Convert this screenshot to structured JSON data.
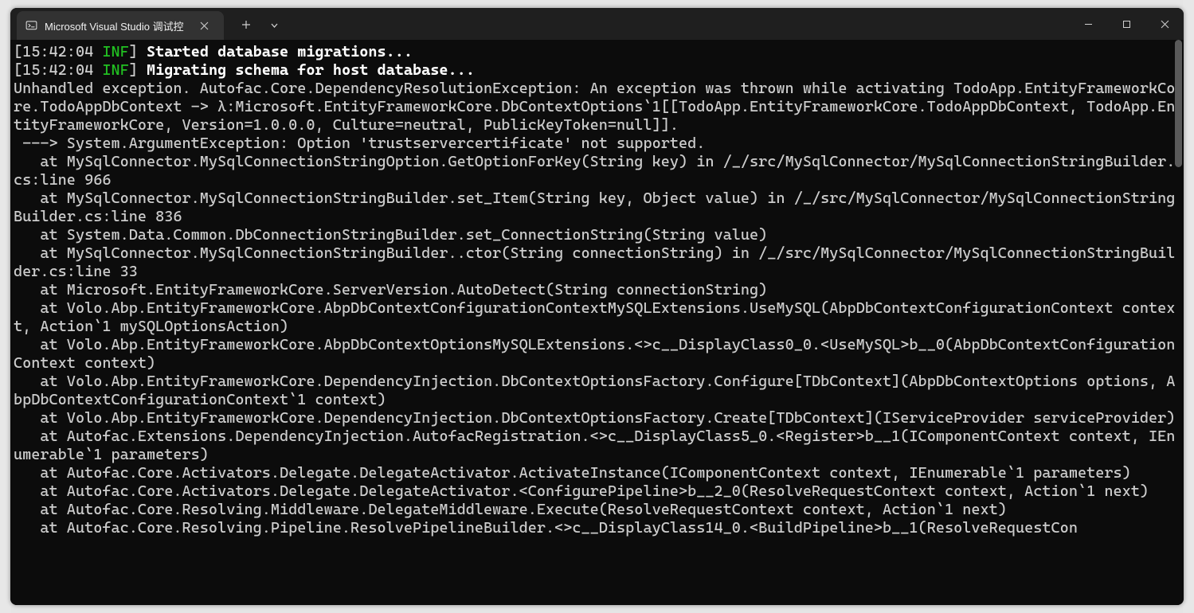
{
  "titlebar": {
    "tab_label": "Microsoft Visual Studio 调试控",
    "icons": {
      "terminal": "terminal-icon",
      "close_tab": "close-icon",
      "new_tab": "plus-icon",
      "dropdown": "chevron-down-icon",
      "minimize": "minimize-icon",
      "maximize": "maximize-icon",
      "win_close": "close-icon"
    }
  },
  "log": {
    "line1_time": "15:42:04",
    "line1_level": "INF",
    "line1_msg": "Started database migrations...",
    "line2_time": "15:42:04",
    "line2_level": "INF",
    "line2_msg": "Migrating schema for host database..."
  },
  "trace": "Unhandled exception. Autofac.Core.DependencyResolutionException: An exception was thrown while activating TodoApp.EntityFrameworkCore.TodoAppDbContext -> λ:Microsoft.EntityFrameworkCore.DbContextOptions`1[[TodoApp.EntityFrameworkCore.TodoAppDbContext, TodoApp.EntityFrameworkCore, Version=1.0.0.0, Culture=neutral, PublicKeyToken=null]].\n ---> System.ArgumentException: Option 'trustservercertificate' not supported.\n   at MySqlConnector.MySqlConnectionStringOption.GetOptionForKey(String key) in /_/src/MySqlConnector/MySqlConnectionStringBuilder.cs:line 966\n   at MySqlConnector.MySqlConnectionStringBuilder.set_Item(String key, Object value) in /_/src/MySqlConnector/MySqlConnectionStringBuilder.cs:line 836\n   at System.Data.Common.DbConnectionStringBuilder.set_ConnectionString(String value)\n   at MySqlConnector.MySqlConnectionStringBuilder..ctor(String connectionString) in /_/src/MySqlConnector/MySqlConnectionStringBuilder.cs:line 33\n   at Microsoft.EntityFrameworkCore.ServerVersion.AutoDetect(String connectionString)\n   at Volo.Abp.EntityFrameworkCore.AbpDbContextConfigurationContextMySQLExtensions.UseMySQL(AbpDbContextConfigurationContext context, Action`1 mySQLOptionsAction)\n   at Volo.Abp.EntityFrameworkCore.AbpDbContextOptionsMySQLExtensions.<>c__DisplayClass0_0.<UseMySQL>b__0(AbpDbContextConfigurationContext context)\n   at Volo.Abp.EntityFrameworkCore.DependencyInjection.DbContextOptionsFactory.Configure[TDbContext](AbpDbContextOptions options, AbpDbContextConfigurationContext`1 context)\n   at Volo.Abp.EntityFrameworkCore.DependencyInjection.DbContextOptionsFactory.Create[TDbContext](IServiceProvider serviceProvider)\n   at Autofac.Extensions.DependencyInjection.AutofacRegistration.<>c__DisplayClass5_0.<Register>b__1(IComponentContext context, IEnumerable`1 parameters)\n   at Autofac.Core.Activators.Delegate.DelegateActivator.ActivateInstance(IComponentContext context, IEnumerable`1 parameters)\n   at Autofac.Core.Activators.Delegate.DelegateActivator.<ConfigurePipeline>b__2_0(ResolveRequestContext context, Action`1 next)\n   at Autofac.Core.Resolving.Middleware.DelegateMiddleware.Execute(ResolveRequestContext context, Action`1 next)\n   at Autofac.Core.Resolving.Pipeline.ResolvePipelineBuilder.<>c__DisplayClass14_0.<BuildPipeline>b__1(ResolveRequestCon"
}
